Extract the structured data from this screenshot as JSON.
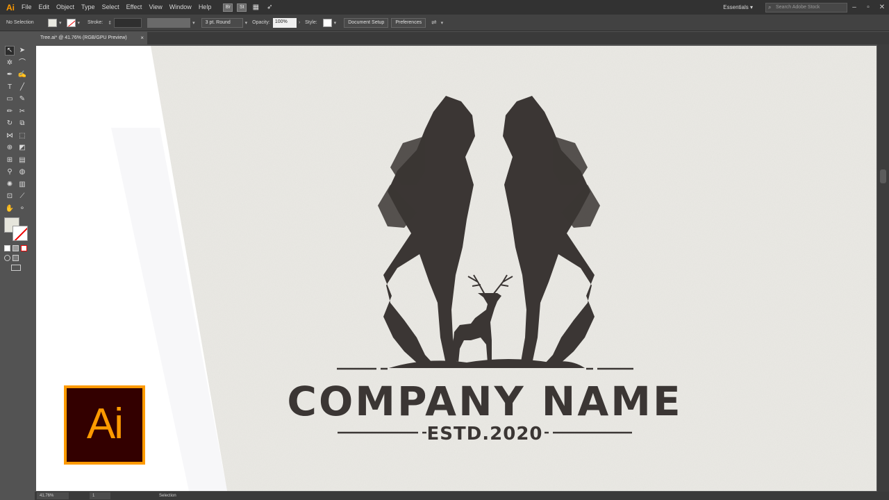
{
  "menubar": {
    "app_icon": "Ai",
    "items": [
      "File",
      "Edit",
      "Object",
      "Type",
      "Select",
      "Effect",
      "View",
      "Window",
      "Help"
    ],
    "bridge": "Br",
    "stock": "St",
    "workspace": "Essentials",
    "search_placeholder": "Search Adobe Stock"
  },
  "controlbar": {
    "selection": "No Selection",
    "stroke_label": "Stroke:",
    "brush": "3 pt. Round",
    "opacity_label": "Opacity:",
    "opacity_value": "100%",
    "style_label": "Style:",
    "doc_setup": "Document Setup",
    "preferences": "Preferences"
  },
  "document_tab": {
    "title": "Tree.ai* @ 41.76% (RGB/GPU Preview)",
    "close": "×"
  },
  "artwork": {
    "company": "COMPANY NAME",
    "established": "ESTD.2020"
  },
  "statusbar": {
    "zoom": "41.76%",
    "artboard": "1",
    "status": "Selection"
  },
  "logo": "Ai",
  "colors": {
    "accent": "#ff9a00",
    "logo_bg": "#330000",
    "ink": "#3b3634",
    "paper": "#ebeae5"
  }
}
